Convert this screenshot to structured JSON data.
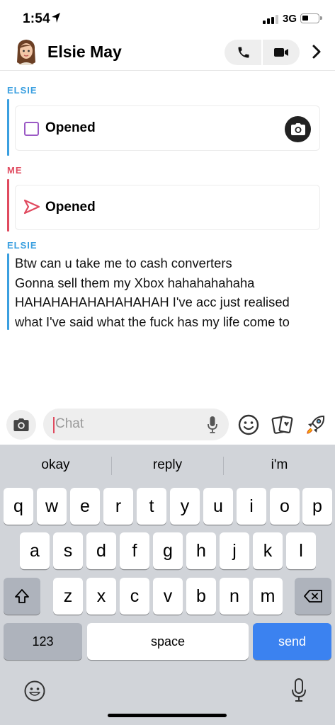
{
  "status": {
    "time": "1:54",
    "network": "3G"
  },
  "header": {
    "contact_name": "Elsie May"
  },
  "messages": [
    {
      "sender": "ELSIE",
      "type": "snap",
      "label": "Opened"
    },
    {
      "sender": "ME",
      "type": "snap",
      "label": "Opened"
    },
    {
      "sender": "ELSIE",
      "type": "text",
      "lines": [
        "Btw can u take me to cash converters",
        "Gonna sell them my Xbox hahahahahaha",
        "HAHAHAHAHAHAHAHAH I've acc just realised",
        "what I've said what the fuck has my life come to"
      ]
    }
  ],
  "input": {
    "placeholder": "Chat",
    "value": ""
  },
  "keyboard": {
    "suggestions": [
      "okay",
      "reply",
      "i'm"
    ],
    "row1": [
      "q",
      "w",
      "e",
      "r",
      "t",
      "y",
      "u",
      "i",
      "o",
      "p"
    ],
    "row2": [
      "a",
      "s",
      "d",
      "f",
      "g",
      "h",
      "j",
      "k",
      "l"
    ],
    "row3": [
      "z",
      "x",
      "c",
      "v",
      "b",
      "n",
      "m"
    ],
    "numbers_key": "123",
    "space_key": "space",
    "send_key": "send"
  },
  "colors": {
    "elsie": "#3a9fe0",
    "me": "#e04a5f",
    "send": "#3b82f0",
    "keyboard_bg": "#d1d4d9"
  }
}
